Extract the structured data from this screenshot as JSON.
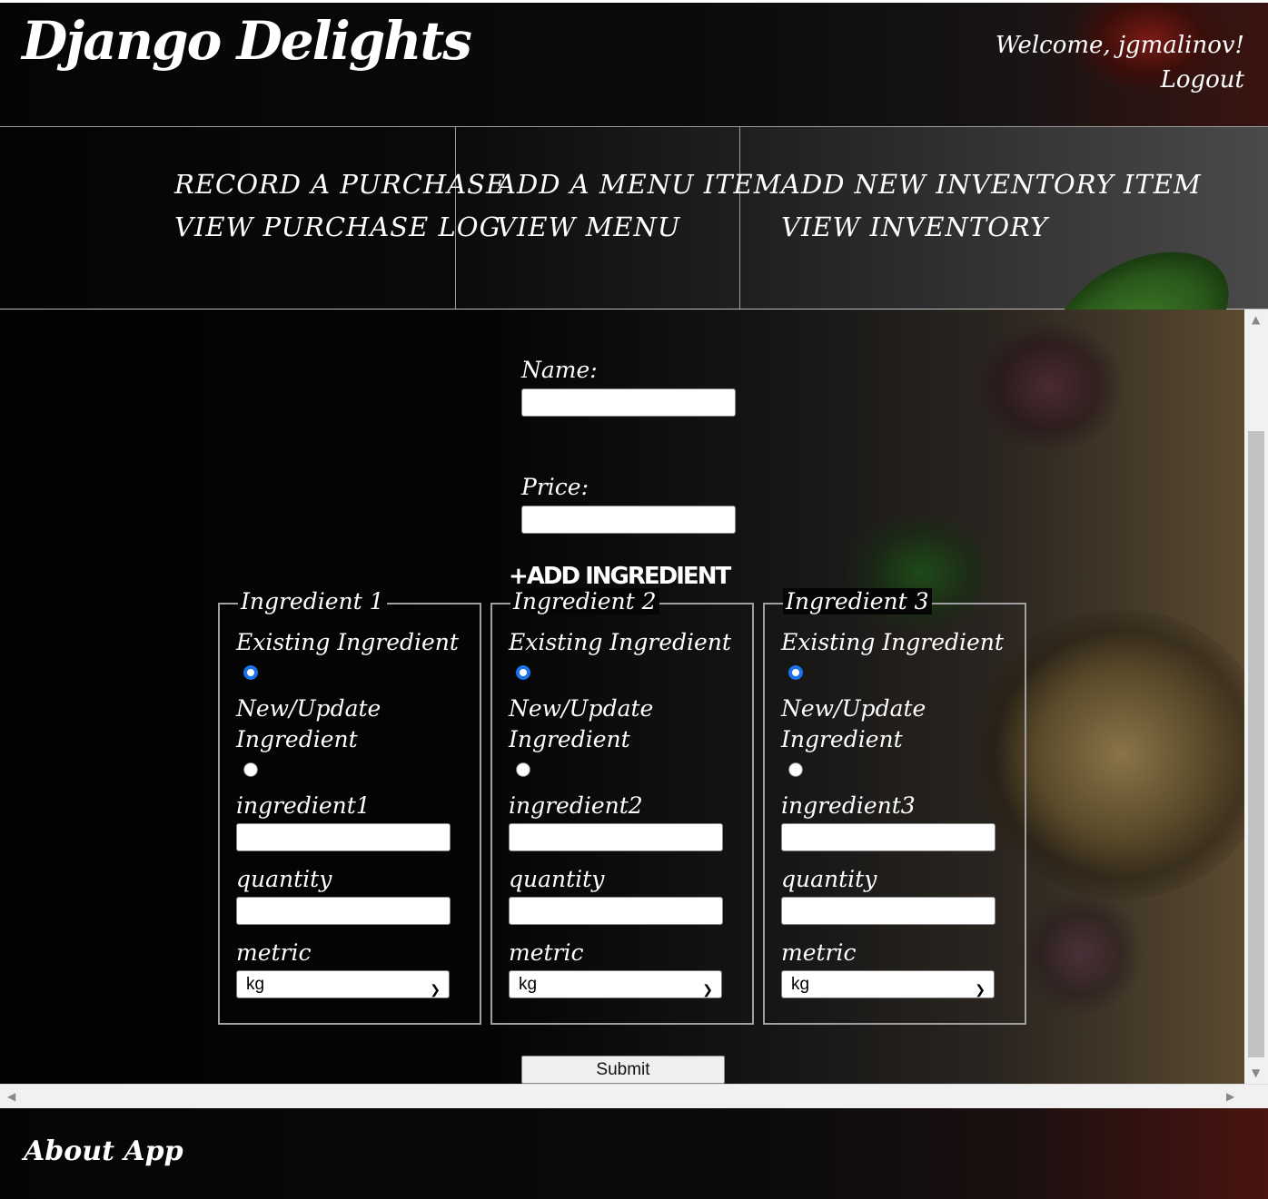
{
  "header": {
    "logo": "Django Delights",
    "welcome": "Welcome, jgmalinov!",
    "logout": "Logout"
  },
  "nav": {
    "col1": [
      "RECORD A PURCHASE",
      "VIEW PURCHASE LOG"
    ],
    "col2": [
      "ADD A MENU ITEM",
      "VIEW MENU"
    ],
    "col3": [
      "ADD NEW INVENTORY ITEM",
      "VIEW INVENTORY"
    ]
  },
  "form": {
    "name_label": "Name:",
    "name_value": "",
    "price_label": "Price:",
    "price_value": "",
    "add_ingredient": "+ADD INGREDIENT",
    "ingredients": [
      {
        "legend": "Ingredient 1",
        "existing_label": "Existing Ingredient",
        "existing_checked": true,
        "new_label": "New/Update Ingredient",
        "field_label": "ingredient1",
        "field_value": "",
        "quantity_label": "quantity",
        "quantity_value": "",
        "metric_label": "metric",
        "metric_value": "kg"
      },
      {
        "legend": "Ingredient 2",
        "existing_label": "Existing Ingredient",
        "existing_checked": true,
        "new_label": "New/Update Ingredient",
        "field_label": "ingredient2",
        "field_value": "",
        "quantity_label": "quantity",
        "quantity_value": "",
        "metric_label": "metric",
        "metric_value": "kg"
      },
      {
        "legend": "Ingredient 3",
        "existing_label": "Existing Ingredient",
        "existing_checked": true,
        "new_label": "New/Update Ingredient",
        "field_label": "ingredient3",
        "field_value": "",
        "quantity_label": "quantity",
        "quantity_value": "",
        "metric_label": "metric",
        "metric_value": "kg"
      }
    ],
    "submit": "Submit"
  },
  "footer": {
    "about": "About App"
  },
  "icons": {
    "scroll_up": "scroll-up-arrow",
    "scroll_down": "scroll-down-arrow",
    "scroll_left": "scroll-left-arrow",
    "scroll_right": "scroll-right-arrow",
    "select_chevron": "chevron-down-icon"
  },
  "colors": {
    "radio_checked": "#1a73e8",
    "background": "#070707",
    "text": "#ffffff"
  }
}
